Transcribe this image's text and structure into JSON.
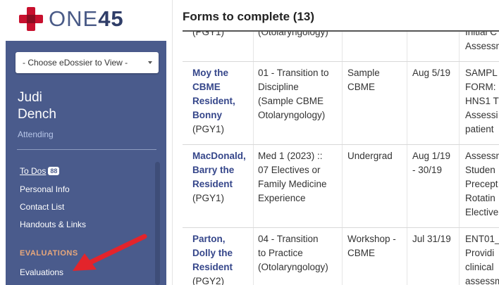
{
  "logo": {
    "part1": "ONE",
    "part2": "45"
  },
  "sidebar": {
    "dossier_select": "- Choose eDossier to View -",
    "user_first": "Judi",
    "user_last": "Dench",
    "user_role": "Attending",
    "nav": {
      "todos": "To Dos",
      "todos_count": "88",
      "personal_info": "Personal Info",
      "contact_list": "Contact List",
      "handouts": "Handouts & Links",
      "evaluations_heading": "EVALUATIONS",
      "evaluations": "Evaluations"
    }
  },
  "main": {
    "title": "Forms to complete (13)",
    "rows": [
      {
        "name": [
          "(PGY1)"
        ],
        "name_link_lines": 0,
        "rotation": [
          "(Otolaryngology)"
        ],
        "type": [
          ""
        ],
        "date": [
          ""
        ],
        "form": [
          "Initial C",
          "Assessm"
        ]
      },
      {
        "name": [
          "Moy the",
          "CBME",
          "Resident,",
          "Bonny",
          "(PGY1)"
        ],
        "name_link_lines": 4,
        "rotation": [
          "01 - Transition to",
          "Discipline",
          "(Sample CBME",
          "Otolaryngology)"
        ],
        "type": [
          "Sample",
          "CBME"
        ],
        "date": [
          "Aug 5/19"
        ],
        "form": [
          "SAMPL",
          "FORM:",
          "HNS1 T",
          "Assessi",
          "patient"
        ]
      },
      {
        "name": [
          "MacDonald,",
          "Barry the",
          "Resident",
          "(PGY1)"
        ],
        "name_link_lines": 3,
        "rotation": [
          "Med 1 (2023) ::",
          "07 Electives or",
          "Family Medicine",
          "Experience"
        ],
        "type": [
          "Undergrad"
        ],
        "date": [
          "Aug 1/19",
          "- 30/19"
        ],
        "form": [
          "Assessn",
          "Studen",
          "Precept",
          "Rotatin",
          "Elective"
        ]
      },
      {
        "name": [
          "Parton,",
          "Dolly the",
          "Resident",
          "(PGY2)"
        ],
        "name_link_lines": 3,
        "rotation": [
          "04 - Transition",
          "to Practice",
          "(Otolaryngology)"
        ],
        "type": [
          "Workshop -",
          "CBME"
        ],
        "date": [
          "Jul 31/19"
        ],
        "form": [
          "ENT01_",
          "Providi",
          "clinical",
          "assessm"
        ]
      }
    ]
  },
  "accent_colors": {
    "panel": "#4a5b8c",
    "brand_red": "#c8102e",
    "arrow": "#e3242b",
    "link": "#35468a"
  }
}
